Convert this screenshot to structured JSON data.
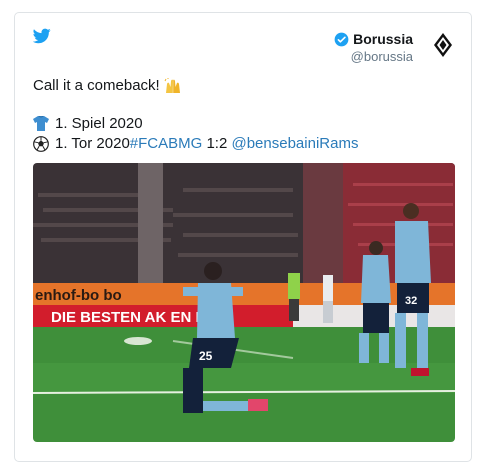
{
  "tweet": {
    "author_name": "Borussia",
    "author_handle": "@borussia",
    "line1": "Call it a comeback!",
    "line2": "1. Spiel 2020",
    "line3_prefix": "1. Tor 2020",
    "line3_hashtag": "#FCABMG",
    "line3_score": " 1:2 ",
    "line3_mention": "@bensebainiRams"
  },
  "photo": {
    "banner_text": "DIE BESTEN AK    EN HITS",
    "hoarding_text": "enhof-bo    bo",
    "player_front_number": "25",
    "player_back_number": "32"
  },
  "colors": {
    "link": "#2b7bb9",
    "twitter_blue": "#1da1f2",
    "pitch": "#3f8f3a",
    "kit": "#7fb6d8"
  },
  "icons": [
    "twitter-logo-icon",
    "verified-badge-icon",
    "club-crest-icon",
    "raised-hands-emoji-icon",
    "jersey-emoji-icon",
    "soccer-ball-emoji-icon"
  ]
}
